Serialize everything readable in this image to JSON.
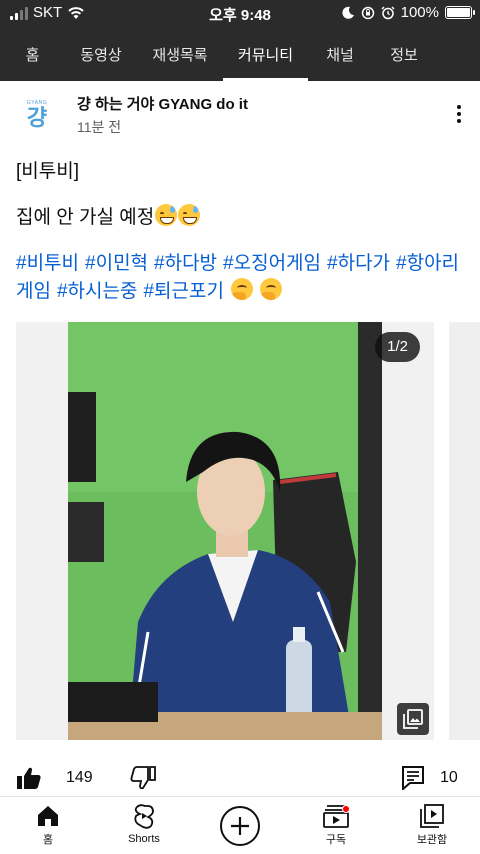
{
  "status_bar": {
    "carrier": "SKT",
    "time": "오후 9:48",
    "battery_percent": "100%",
    "battery_level": 1.0
  },
  "channel_tabs": [
    {
      "label": "홈",
      "active": false
    },
    {
      "label": "동영상",
      "active": false
    },
    {
      "label": "재생목록",
      "active": false
    },
    {
      "label": "커뮤니티",
      "active": true
    },
    {
      "label": "채널",
      "active": false
    },
    {
      "label": "정보",
      "active": false
    }
  ],
  "post": {
    "avatar": {
      "small_text": "GYANG",
      "big_text": "걍"
    },
    "channel_name": "걍 하는 거야 GYANG do it",
    "time_ago": "11분 전",
    "line1": "[비투비]",
    "line2": "집에 안 가실 예정",
    "hashtags": [
      "#비투비",
      "#이민혁",
      "#하다방",
      "#오징어게임",
      "#하다가",
      "#항아리게임",
      "#하시는중",
      "#퇴근포기"
    ],
    "image_counter": "1/2",
    "likes": "149",
    "comments": "10"
  },
  "bottom_nav": [
    {
      "label": "홈",
      "icon": "home-icon"
    },
    {
      "label": "Shorts",
      "icon": "shorts-icon"
    },
    {
      "label": "",
      "icon": "create-icon"
    },
    {
      "label": "구독",
      "icon": "subscriptions-icon"
    },
    {
      "label": "보관함",
      "icon": "library-icon"
    }
  ],
  "colors": {
    "header_bg": "#2b2b2b",
    "hashtag": "#065fd4",
    "notification_dot": "#ff0000"
  }
}
